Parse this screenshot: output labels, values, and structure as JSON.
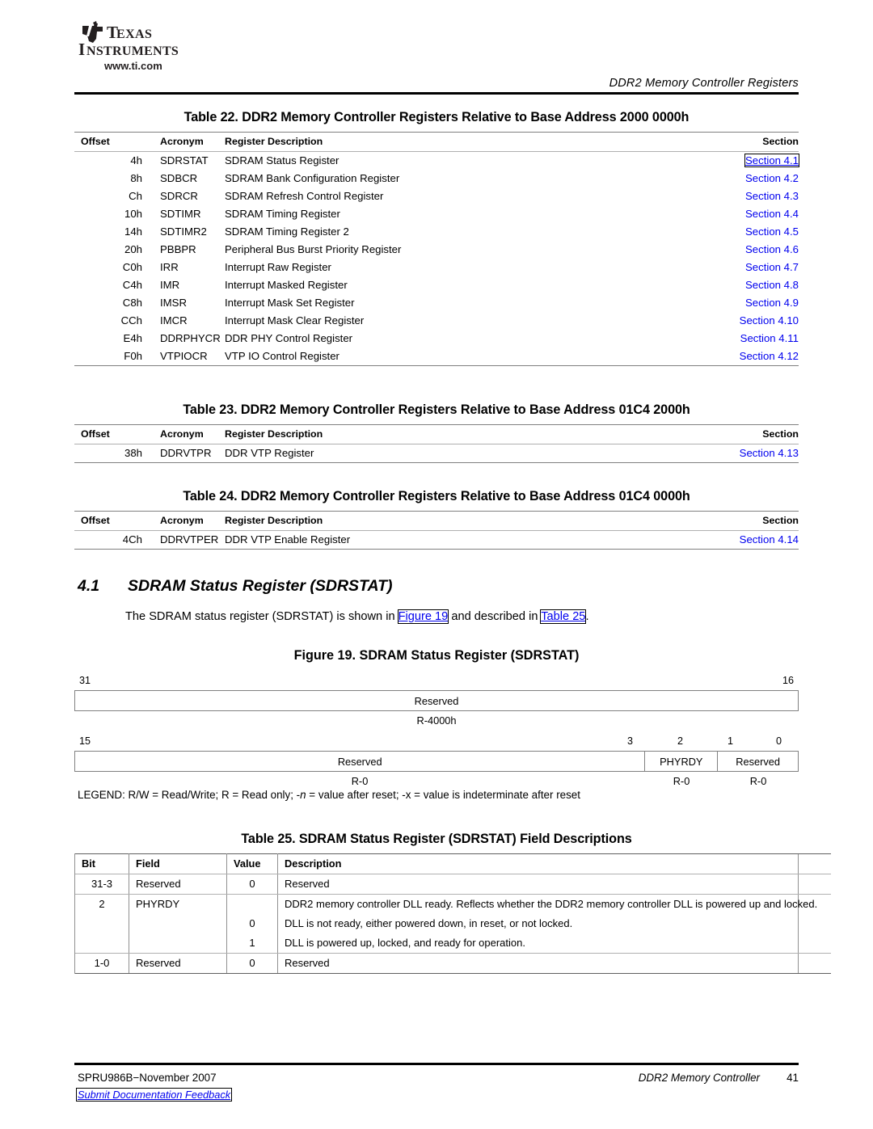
{
  "header": {
    "logo_line1": "TEXAS",
    "logo_line2": "INSTRUMENTS",
    "logo_url": "www.ti.com",
    "running_title": "DDR2 Memory Controller Registers"
  },
  "table22": {
    "caption": "Table 22. DDR2 Memory Controller Registers Relative to Base Address 2000 0000h",
    "columns": [
      "Offset",
      "Acronym",
      "Register Description",
      "Section"
    ],
    "rows": [
      {
        "offset": "4h",
        "acronym": "SDRSTAT",
        "description": "SDRAM Status Register",
        "section": "Section 4.1",
        "focused": true
      },
      {
        "offset": "8h",
        "acronym": "SDBCR",
        "description": "SDRAM Bank Configuration Register",
        "section": "Section 4.2",
        "focused": false
      },
      {
        "offset": "Ch",
        "acronym": "SDRCR",
        "description": "SDRAM Refresh Control Register",
        "section": "Section 4.3",
        "focused": false
      },
      {
        "offset": "10h",
        "acronym": "SDTIMR",
        "description": "SDRAM Timing Register",
        "section": "Section 4.4",
        "focused": false
      },
      {
        "offset": "14h",
        "acronym": "SDTIMR2",
        "description": "SDRAM Timing Register 2",
        "section": "Section 4.5",
        "focused": false
      },
      {
        "offset": "20h",
        "acronym": "PBBPR",
        "description": "Peripheral Bus Burst Priority Register",
        "section": "Section 4.6",
        "focused": false
      },
      {
        "offset": "C0h",
        "acronym": "IRR",
        "description": "Interrupt Raw Register",
        "section": "Section 4.7",
        "focused": false
      },
      {
        "offset": "C4h",
        "acronym": "IMR",
        "description": "Interrupt Masked Register",
        "section": "Section 4.8",
        "focused": false
      },
      {
        "offset": "C8h",
        "acronym": "IMSR",
        "description": "Interrupt Mask Set Register",
        "section": "Section 4.9",
        "focused": false
      },
      {
        "offset": "CCh",
        "acronym": "IMCR",
        "description": "Interrupt Mask Clear Register",
        "section": "Section 4.10",
        "focused": false
      },
      {
        "offset": "E4h",
        "acronym": "DDRPHYCR",
        "description": "DDR PHY Control Register",
        "section": "Section 4.11",
        "focused": false
      },
      {
        "offset": "F0h",
        "acronym": "VTPIOCR",
        "description": "VTP IO Control Register",
        "section": "Section 4.12",
        "focused": false
      }
    ]
  },
  "table23": {
    "caption": "Table 23. DDR2 Memory Controller Registers Relative to Base Address 01C4 2000h",
    "columns": [
      "Offset",
      "Acronym",
      "Register Description",
      "Section"
    ],
    "rows": [
      {
        "offset": "38h",
        "acronym": "DDRVTPR",
        "description": "DDR VTP Register",
        "section": "Section 4.13",
        "focused": false
      }
    ]
  },
  "table24": {
    "caption": "Table 24. DDR2 Memory Controller Registers Relative to Base Address 01C4 0000h",
    "columns": [
      "Offset",
      "Acronym",
      "Register Description",
      "Section"
    ],
    "rows": [
      {
        "offset": "4Ch",
        "acronym": "DDRVTPER",
        "description": "DDR VTP Enable Register",
        "section": "Section 4.14",
        "focused": false
      }
    ]
  },
  "section41": {
    "number": "4.1",
    "title": "SDRAM Status Register (SDRSTAT)",
    "para_part1": "The SDRAM status register (SDRSTAT) is shown in ",
    "para_link1": "Figure 19",
    "para_part2": " and described in ",
    "para_link2": "Table 25",
    "para_part3": "."
  },
  "figure19": {
    "caption": "Figure 19. SDRAM Status Register (SDRSTAT)",
    "row1": {
      "bit_left": "31",
      "bit_right": "16",
      "fields": [
        {
          "name": "Reserved",
          "reset": "R-4000h"
        }
      ]
    },
    "row2": {
      "bit_labels": [
        "15",
        "3",
        "2",
        "1",
        "0"
      ],
      "fields": [
        {
          "name": "Reserved",
          "reset": "R-0"
        },
        {
          "name": "PHYRDY",
          "reset": "R-0"
        },
        {
          "name": "Reserved",
          "reset": "R-0"
        }
      ]
    },
    "legend": "LEGEND: R/W = Read/Write; R = Read only; -n = value after reset; -x = value is indeterminate after reset",
    "legend_pre": "LEGEND: R/W = Read/Write; R = Read only; -",
    "legend_italic": "n",
    "legend_post": " = value after reset; -x = value is indeterminate after reset"
  },
  "table25": {
    "caption": "Table 25. SDRAM Status Register (SDRSTAT) Field Descriptions",
    "columns": [
      "Bit",
      "Field",
      "Value",
      "Description"
    ],
    "rows": [
      {
        "bit": "31-3",
        "field": "Reserved",
        "value": "0",
        "description": "Reserved"
      },
      {
        "bit": "2",
        "field": "PHYRDY",
        "value": "",
        "description": "DDR2 memory controller DLL ready. Reflects whether the DDR2 memory controller DLL is powered up and locked."
      },
      {
        "bit": "",
        "field": "",
        "value": "0",
        "description": "DLL is not ready, either powered down, in reset, or not locked."
      },
      {
        "bit": "",
        "field": "",
        "value": "1",
        "description": "DLL is powered up, locked, and ready for operation."
      },
      {
        "bit": "1-0",
        "field": "Reserved",
        "value": "0",
        "description": "Reserved"
      }
    ]
  },
  "footer": {
    "doc_id": "SPRU986B−November 2007",
    "doc_title": "DDR2 Memory Controller",
    "page_number": "41",
    "feedback_link": "Submit Documentation Feedback"
  },
  "colors": {
    "link": "#0000ee",
    "rule": "#000000",
    "table_rule": "#808080"
  }
}
